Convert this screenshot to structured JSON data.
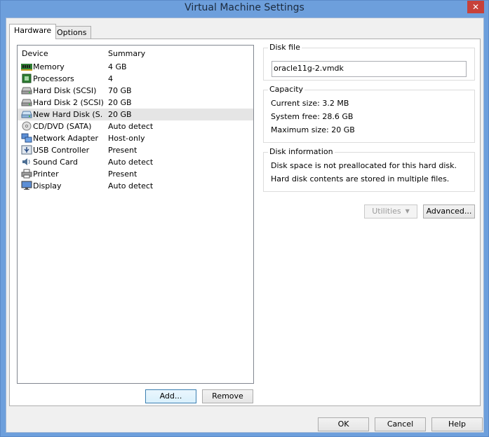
{
  "window": {
    "title": "Virtual Machine Settings",
    "close": "✕"
  },
  "tabs": [
    {
      "label": "Hardware",
      "active": true
    },
    {
      "label": "Options",
      "active": false
    }
  ],
  "device_list": {
    "headers": {
      "device": "Device",
      "summary": "Summary"
    },
    "rows": [
      {
        "name": "Memory",
        "summary": "4 GB",
        "icon": "memory-icon"
      },
      {
        "name": "Processors",
        "summary": "4",
        "icon": "processor-icon"
      },
      {
        "name": "Hard Disk (SCSI)",
        "summary": "70 GB",
        "icon": "hard-disk-icon"
      },
      {
        "name": "Hard Disk 2 (SCSI)",
        "summary": "20 GB",
        "icon": "hard-disk-icon"
      },
      {
        "name": "New Hard Disk (S...",
        "summary": "20 GB",
        "icon": "hard-disk-icon",
        "selected": true
      },
      {
        "name": "CD/DVD (SATA)",
        "summary": "Auto detect",
        "icon": "cd-dvd-icon"
      },
      {
        "name": "Network Adapter",
        "summary": "Host-only",
        "icon": "network-adapter-icon"
      },
      {
        "name": "USB Controller",
        "summary": "Present",
        "icon": "usb-icon"
      },
      {
        "name": "Sound Card",
        "summary": "Auto detect",
        "icon": "sound-card-icon"
      },
      {
        "name": "Printer",
        "summary": "Present",
        "icon": "printer-icon"
      },
      {
        "name": "Display",
        "summary": "Auto detect",
        "icon": "display-icon"
      }
    ],
    "add_label": "Add...",
    "remove_label": "Remove"
  },
  "disk_file": {
    "legend": "Disk file",
    "value": "oracle11g-2.vmdk"
  },
  "capacity": {
    "legend": "Capacity",
    "current_size": "Current size: 3.2 MB",
    "system_free": "System free: 28.6 GB",
    "maximum_size": "Maximum size: 20 GB"
  },
  "disk_info": {
    "legend": "Disk information",
    "line1": "Disk space is not preallocated for this hard disk.",
    "line2": "Hard disk contents are stored in multiple files."
  },
  "actions": {
    "utilities_label": "Utilities",
    "advanced_label": "Advanced..."
  },
  "footer": {
    "ok_label": "OK",
    "cancel_label": "Cancel",
    "help_label": "Help"
  }
}
